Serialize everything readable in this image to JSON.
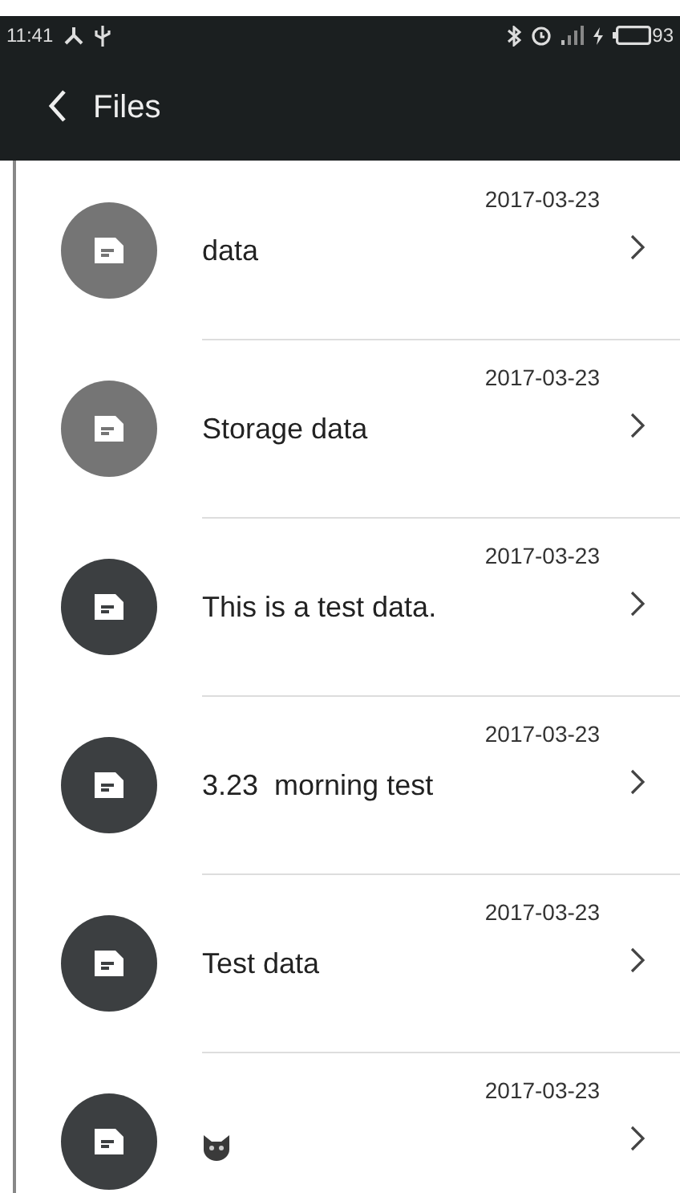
{
  "status_bar": {
    "time": "11:41",
    "battery": "93"
  },
  "header": {
    "title": "Files"
  },
  "files": [
    {
      "kind": "text",
      "name": "data",
      "date": "2017-03-23",
      "color": "#757575"
    },
    {
      "kind": "text",
      "name": "Storage data",
      "date": "2017-03-23",
      "color": "#757575"
    },
    {
      "kind": "text",
      "name": "This is a test data.",
      "date": "2017-03-23",
      "color": "#3c3f41"
    },
    {
      "kind": "text",
      "name": "3.23  morning test",
      "date": "2017-03-23",
      "color": "#3c3f41"
    },
    {
      "kind": "text",
      "name": "Test data",
      "date": "2017-03-23",
      "color": "#3c3f41"
    },
    {
      "kind": "emoji",
      "date": "2017-03-23",
      "color": "#3c3f41"
    }
  ]
}
